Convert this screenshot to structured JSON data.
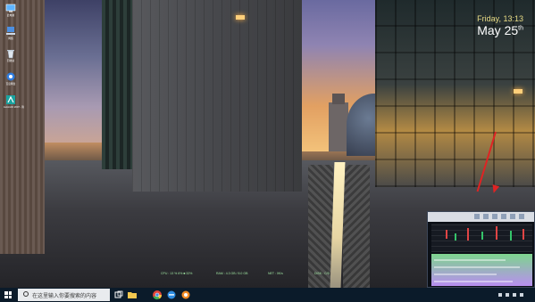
{
  "desktop": {
    "icons": [
      {
        "name": "computer-icon",
        "label": "此电脑"
      },
      {
        "name": "network-icon",
        "label": "网络"
      },
      {
        "name": "recycle-bin-icon",
        "label": "回收站"
      },
      {
        "name": "cloud-drive-icon",
        "label": "百度网盘"
      },
      {
        "name": "autocad-icon",
        "label": "AutoCAD 2007 - 简"
      }
    ]
  },
  "clock_widget": {
    "day_time": "Friday, 13:13",
    "month": "May",
    "day": "25",
    "day_suffix": "th"
  },
  "system_monitor": {
    "items": [
      "CPU : 13 % 6% ■ 32%",
      "RAM : 4.3 GB / 8.0 GB",
      "NET : 0K/s",
      "DISK : C/D"
    ]
  },
  "thumbnail_preview": {
    "app": "stock-trading-app"
  },
  "taskbar": {
    "search_placeholder": "在这里输入你要搜索的内容",
    "pinned": [
      {
        "name": "task-view-icon"
      },
      {
        "name": "file-explorer-icon"
      },
      {
        "name": "chrome-icon"
      },
      {
        "name": "ie-browser-icon"
      },
      {
        "name": "qq-browser-icon"
      }
    ]
  },
  "colors": {
    "accent_arrow": "#e02323",
    "taskbar": "#0b1b2a",
    "clock_text": "#e9dc85"
  }
}
